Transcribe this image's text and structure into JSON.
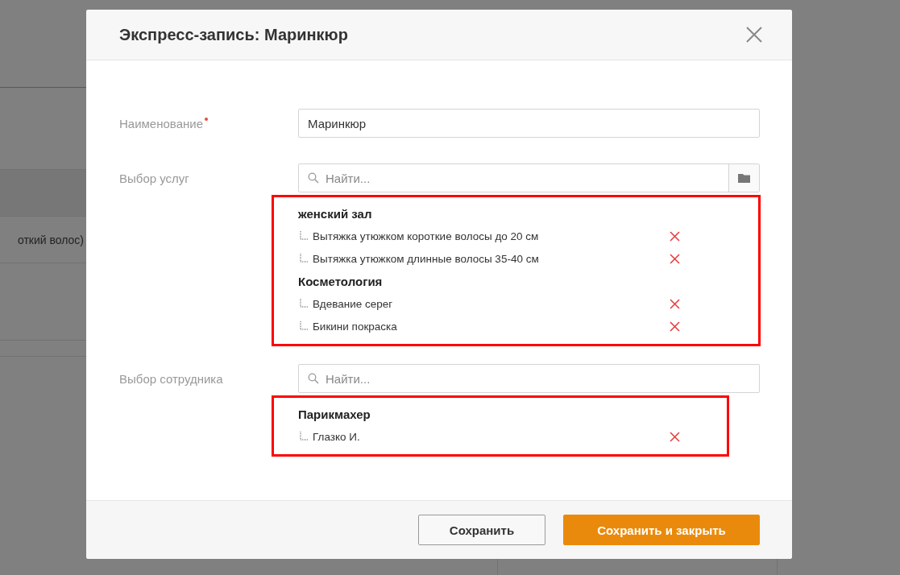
{
  "background": {
    "row_text": "откий волос)"
  },
  "dialog": {
    "title": "Экспресс-запись: Маринкюр",
    "name_field": {
      "label": "Наименование",
      "required": true,
      "value": "Маринкюр"
    },
    "services": {
      "label": "Выбор услуг",
      "placeholder": "Найти...",
      "groups": [
        {
          "title": "женский зал",
          "items": [
            "Вытяжка утюжком короткие волосы до 20 см",
            "Вытяжка утюжком длинные волосы 35-40 см"
          ]
        },
        {
          "title": "Косметология",
          "items": [
            "Вдевание серег",
            "Бикини покраска"
          ]
        }
      ]
    },
    "employees": {
      "label": "Выбор сотрудника",
      "placeholder": "Найти...",
      "groups": [
        {
          "title": "Парикмахер",
          "items": [
            "Глазко И."
          ]
        }
      ]
    },
    "buttons": [
      {
        "label": "Сохранить",
        "kind": "secondary"
      },
      {
        "label": "Сохранить и закрыть",
        "kind": "primary"
      }
    ]
  }
}
